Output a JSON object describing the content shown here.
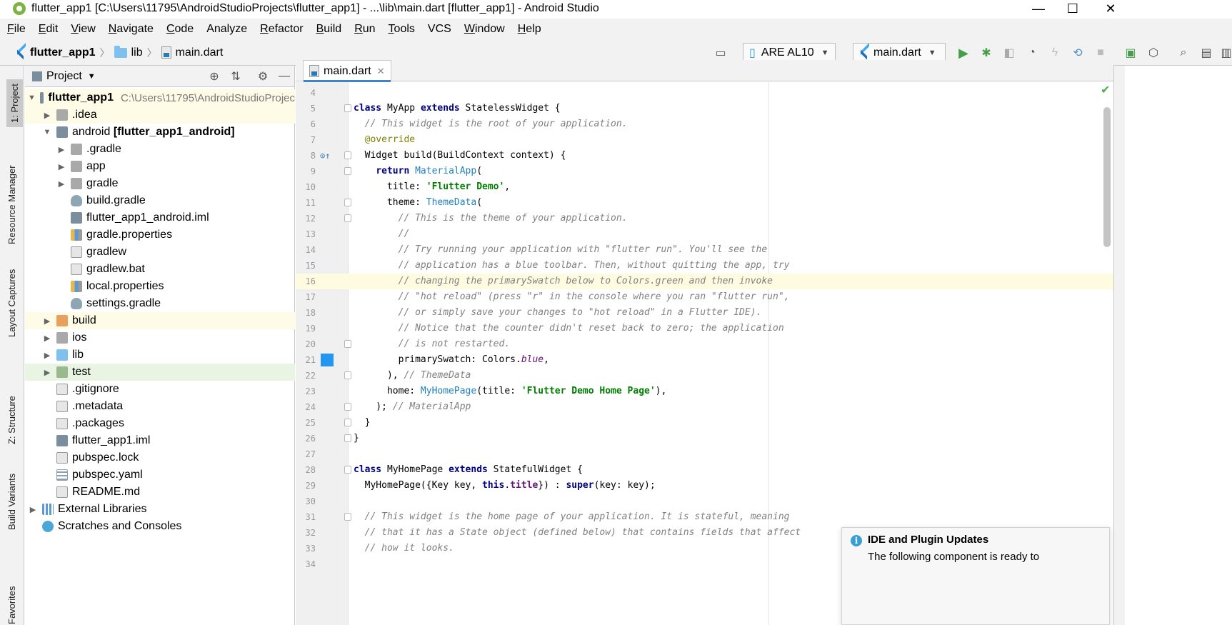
{
  "window": {
    "title": "flutter_app1 [C:\\Users\\11795\\AndroidStudioProjects\\flutter_app1] - ...\\lib\\main.dart [flutter_app1] - Android Studio",
    "minimize": "—",
    "maximize": "☐",
    "close": "✕"
  },
  "menu": [
    {
      "u": "F",
      "rest": "ile"
    },
    {
      "u": "E",
      "rest": "dit"
    },
    {
      "u": "V",
      "rest": "iew"
    },
    {
      "u": "N",
      "rest": "avigate"
    },
    {
      "u": "C",
      "rest": "ode"
    },
    {
      "u": "",
      "rest": "Analyze"
    },
    {
      "u": "R",
      "rest": "efactor"
    },
    {
      "u": "B",
      "rest": "uild"
    },
    {
      "u": "R",
      "rest": "un"
    },
    {
      "u": "T",
      "rest": "ools"
    },
    {
      "u": "",
      "rest": "VCS"
    },
    {
      "u": "W",
      "rest": "indow"
    },
    {
      "u": "H",
      "rest": "elp"
    }
  ],
  "breadcrumb": [
    "flutter_app1",
    "lib",
    "main.dart"
  ],
  "toolbar": {
    "device": "ARE AL10",
    "run_config": "main.dart"
  },
  "left_tools": [
    "1: Project",
    "Resource Manager",
    "Layout Captures",
    "Z: Structure",
    "Build Variants",
    "Favorites"
  ],
  "project_panel": {
    "title": "Project",
    "tree": [
      {
        "label": "flutter_app1",
        "extra": "C:\\Users\\11795\\AndroidStudioProjec",
        "bold": true
      },
      {
        "label": ".idea"
      },
      {
        "label": "android",
        "extra": "[flutter_app1_android]"
      },
      {
        "label": ".gradle"
      },
      {
        "label": "app"
      },
      {
        "label": "gradle"
      },
      {
        "label": "build.gradle"
      },
      {
        "label": "flutter_app1_android.iml"
      },
      {
        "label": "gradle.properties"
      },
      {
        "label": "gradlew"
      },
      {
        "label": "gradlew.bat"
      },
      {
        "label": "local.properties"
      },
      {
        "label": "settings.gradle"
      },
      {
        "label": "build"
      },
      {
        "label": "ios"
      },
      {
        "label": "lib"
      },
      {
        "label": "test"
      },
      {
        "label": ".gitignore"
      },
      {
        "label": ".metadata"
      },
      {
        "label": ".packages"
      },
      {
        "label": "flutter_app1.iml"
      },
      {
        "label": "pubspec.lock"
      },
      {
        "label": "pubspec.yaml"
      },
      {
        "label": "README.md"
      },
      {
        "label": "External Libraries"
      },
      {
        "label": "Scratches and Consoles"
      }
    ]
  },
  "editor": {
    "tab": "main.dart",
    "line_numbers": [
      "4",
      "5",
      "6",
      "7",
      "8",
      "9",
      "10",
      "11",
      "12",
      "13",
      "14",
      "15",
      "16",
      "17",
      "18",
      "19",
      "20",
      "21",
      "22",
      "23",
      "24",
      "25",
      "26",
      "27",
      "28",
      "29",
      "30",
      "31",
      "32",
      "33",
      "34"
    ]
  },
  "notification": {
    "title": "IDE and Plugin Updates",
    "body": "The following component is ready to"
  }
}
